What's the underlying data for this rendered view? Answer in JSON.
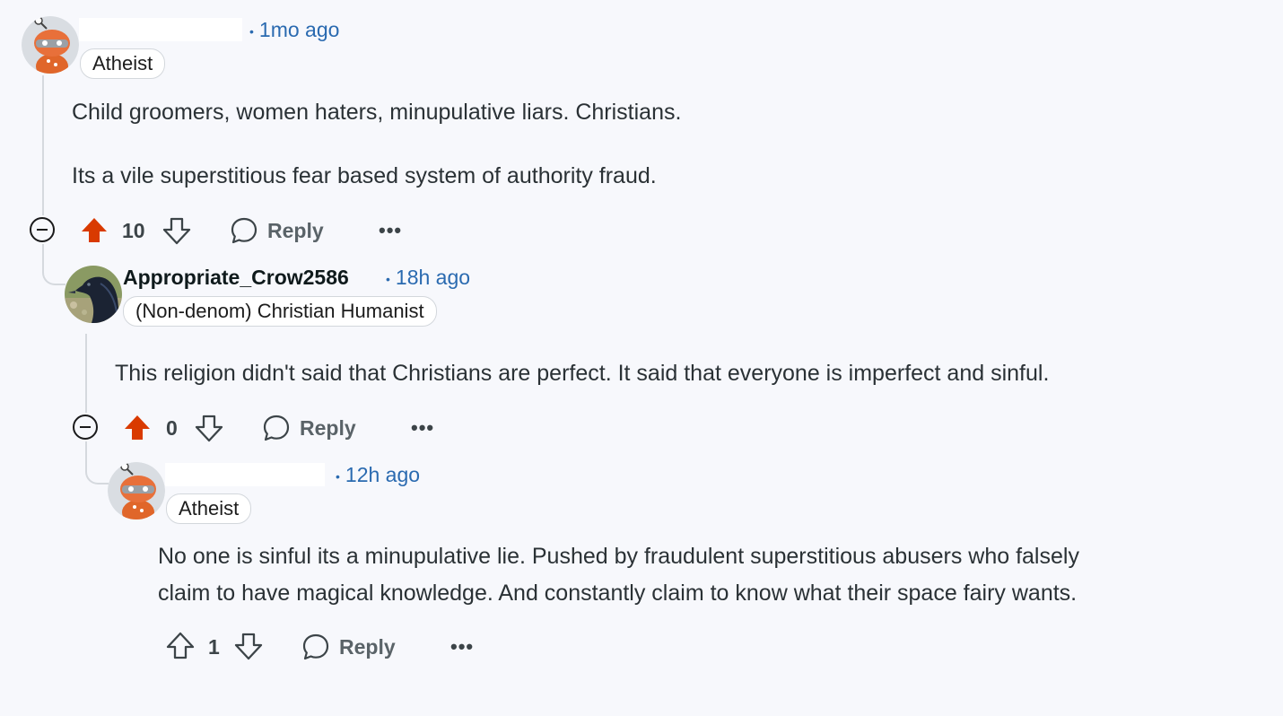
{
  "comments": [
    {
      "username": "",
      "time": "1mo ago",
      "flair": "Atheist",
      "body": [
        "Child groomers, women haters, minupulative liars. Christians.",
        "Its a vile superstitious fear based system of authority fraud."
      ],
      "score": "10",
      "upvoted": true,
      "reply_label": "Reply",
      "more_label": "•••"
    },
    {
      "username": "Appropriate_Crow2586",
      "time": "18h ago",
      "flair": "(Non-denom) Christian Humanist",
      "body": [
        "This religion didn't said that Christians are perfect. It said that everyone is imperfect and sinful."
      ],
      "score": "0",
      "upvoted": true,
      "reply_label": "Reply",
      "more_label": "•••"
    },
    {
      "username": "",
      "time": "12h ago",
      "flair": "Atheist",
      "body": [
        "No one is sinful its a minupulative lie. Pushed by fraudulent superstitious abusers who falsely",
        "claim to have magical knowledge. And constantly claim to know what their space fairy wants."
      ],
      "score": "1",
      "upvoted": false,
      "reply_label": "Reply",
      "more_label": "•••"
    }
  ],
  "colors": {
    "upvote": "#d93a00",
    "meta": "#2a6ab0",
    "thread": "#d5d9de"
  },
  "icons": [
    "snoo-avatar-icon",
    "crow-avatar-icon",
    "collapse-icon",
    "upvote-icon",
    "downvote-icon",
    "reply-bubble-icon",
    "more-icon"
  ]
}
